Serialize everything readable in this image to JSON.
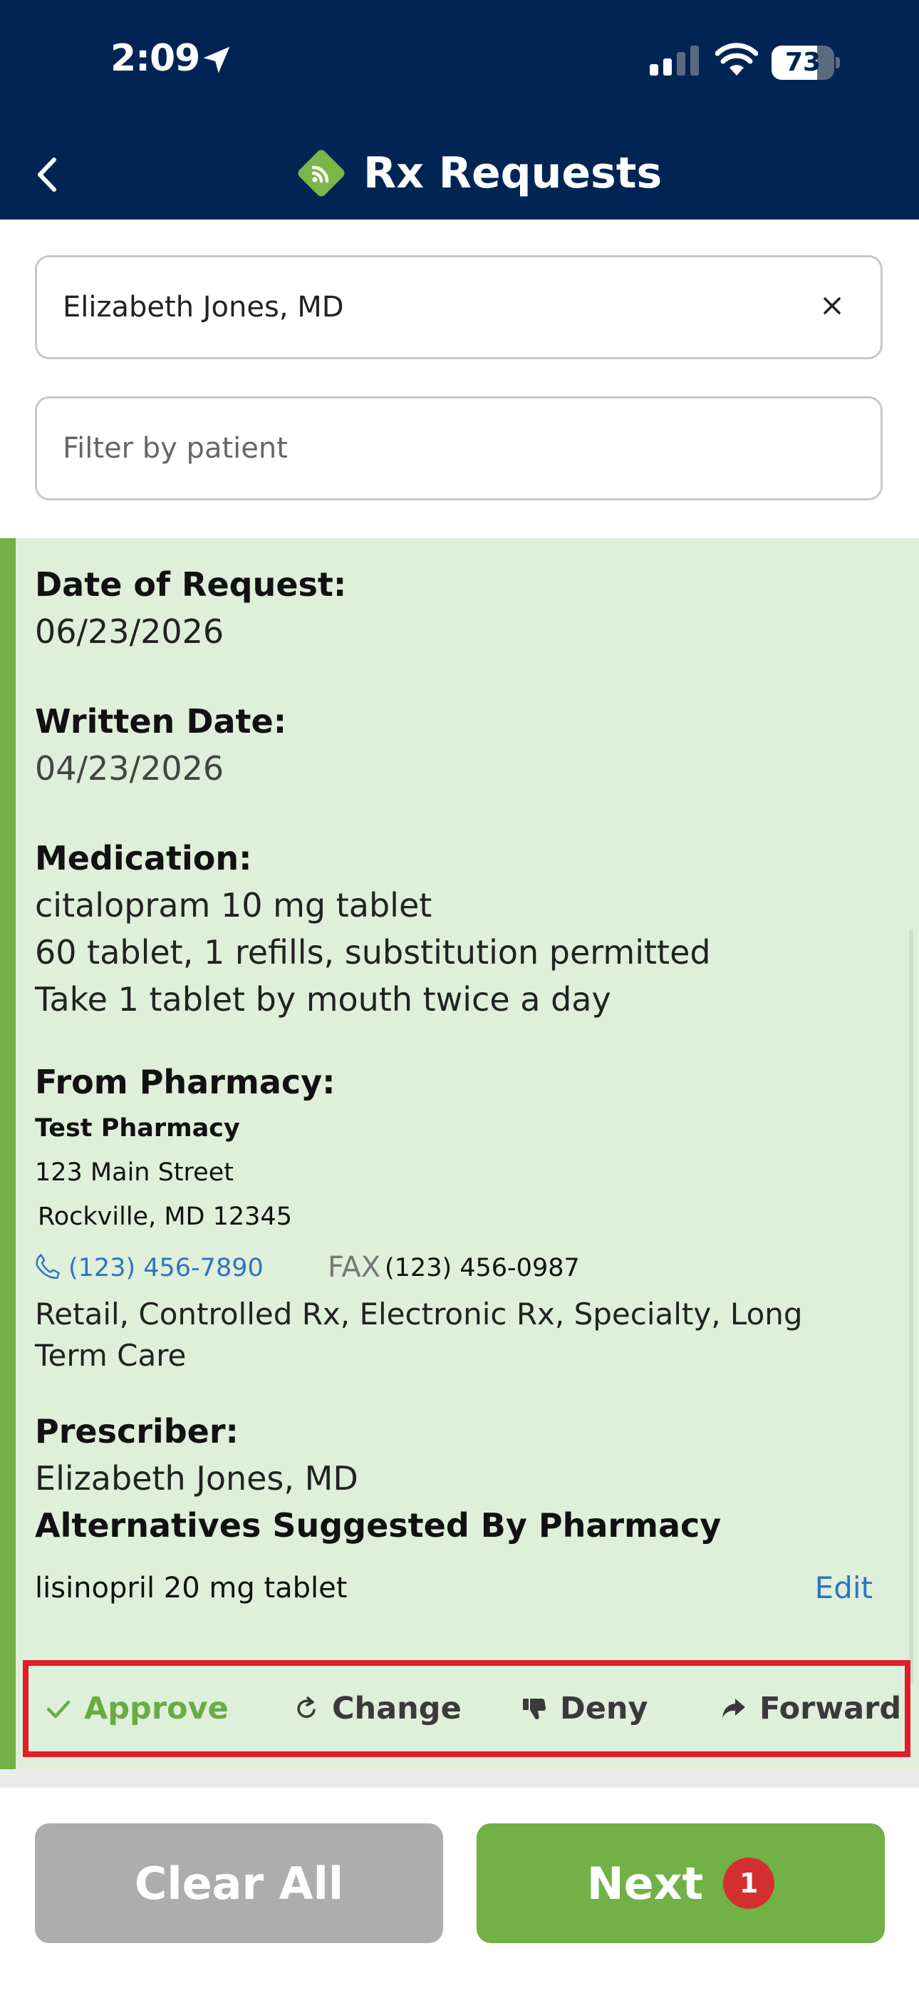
{
  "status_bar": {
    "time": "2:09",
    "battery": "73",
    "battery_level": 0.73
  },
  "header": {
    "title": "Rx Requests"
  },
  "filters": {
    "prescriber": {
      "value": "Elizabeth Jones, MD"
    },
    "patient": {
      "placeholder": "Filter by patient"
    }
  },
  "request": {
    "date_of_request_label": "Date of Request:",
    "date_of_request": "06/23/2026",
    "written_date_label": "Written Date:",
    "written_date": "04/23/2026",
    "medication_label": "Medication:",
    "medication_name": "citalopram 10 mg tablet",
    "medication_quantity": "60 tablet, 1 refills, substitution permitted",
    "medication_sig": "Take 1 tablet by mouth twice a day",
    "pharmacy_label": "From Pharmacy:",
    "pharmacy_name": "Test Pharmacy",
    "pharmacy_street": "123 Main Street",
    "pharmacy_city": "Rockville, MD 12345",
    "pharmacy_phone": "(123) 456-7890",
    "pharmacy_fax_label": "FAX",
    "pharmacy_fax": "(123) 456-0987",
    "pharmacy_types": "Retail, Controlled Rx, Electronic Rx, Specialty, Long Term Care",
    "prescriber_label": "Prescriber:",
    "prescriber_name": "Elizabeth Jones, MD",
    "alternatives_label": "Alternatives Suggested By Pharmacy",
    "alternative_med": "lisinopril 20 mg tablet",
    "edit_label": "Edit"
  },
  "actions": {
    "approve": "Approve",
    "change": "Change",
    "deny": "Deny",
    "forward": "Forward"
  },
  "footer": {
    "clear_all": "Clear All",
    "next": "Next",
    "next_badge": "1"
  },
  "colors": {
    "header_bg": "#002554",
    "accent_green": "#71b146",
    "card_bg": "#dff0da",
    "link_blue": "#2f74c0",
    "highlight_red": "#e21c2a",
    "badge_red": "#d42f2f"
  }
}
